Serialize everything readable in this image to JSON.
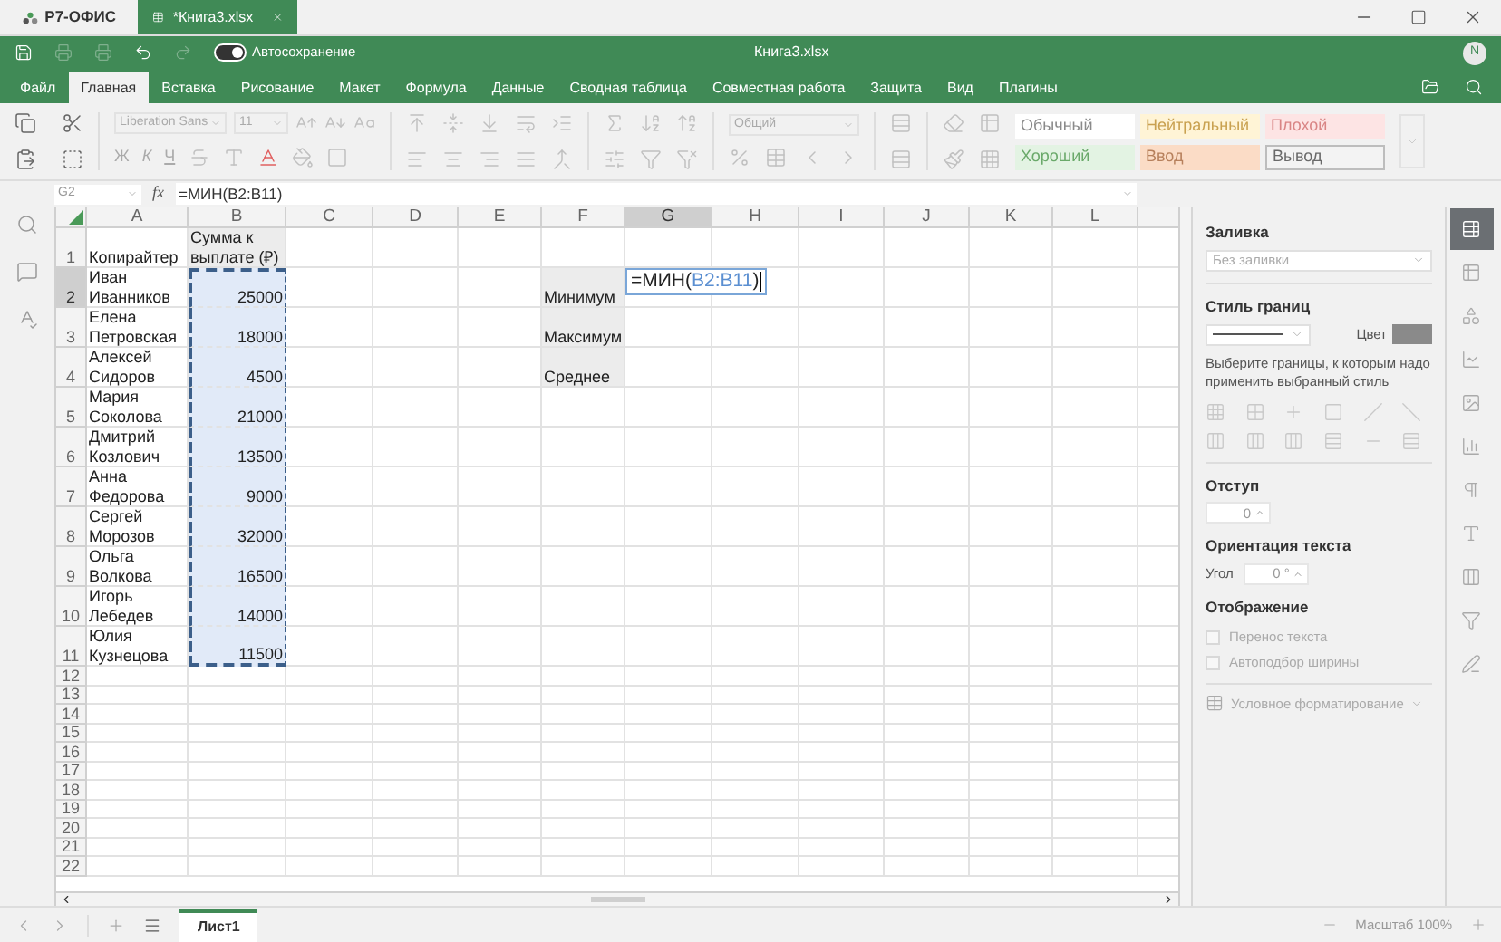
{
  "title_bar": {
    "app_name": "Р7-ОФИС",
    "document_tab": "*Книга3.xlsx"
  },
  "quick_bar": {
    "autosave": {
      "label": "Автосохранение",
      "on": true
    },
    "document_title": "Книга3.xlsx",
    "user_initial": "N"
  },
  "menu_tabs": [
    {
      "label": "Файл",
      "selected": false
    },
    {
      "label": "Главная",
      "selected": true
    },
    {
      "label": "Вставка",
      "selected": false
    },
    {
      "label": "Рисование",
      "selected": false
    },
    {
      "label": "Макет",
      "selected": false
    },
    {
      "label": "Формула",
      "selected": false
    },
    {
      "label": "Данные",
      "selected": false
    },
    {
      "label": "Сводная таблица",
      "selected": false
    },
    {
      "label": "Совместная работа",
      "selected": false
    },
    {
      "label": "Защита",
      "selected": false
    },
    {
      "label": "Вид",
      "selected": false
    },
    {
      "label": "Плагины",
      "selected": false
    }
  ],
  "ribbon": {
    "font_name": "Liberation Sans",
    "font_size": "11",
    "format_letters": [
      "Ж",
      "К",
      "Ч"
    ],
    "number_format": "Общий",
    "cell_styles": [
      {
        "label": "Обычный",
        "kind": "normal"
      },
      {
        "label": "Нейтральный",
        "kind": "neutral"
      },
      {
        "label": "Плохой",
        "kind": "bad"
      },
      {
        "label": "Хороший",
        "kind": "good"
      },
      {
        "label": "Ввод",
        "kind": "input"
      },
      {
        "label": "Вывод",
        "kind": "output"
      }
    ]
  },
  "formula_bar": {
    "cell_ref": "G2",
    "fx_label": "fx",
    "formula": "=МИН(B2:B11)"
  },
  "sheet": {
    "columns": [
      {
        "label": "A",
        "selected": false
      },
      {
        "label": "B",
        "selected": false
      },
      {
        "label": "C",
        "selected": false
      },
      {
        "label": "D",
        "selected": false
      },
      {
        "label": "E",
        "selected": false
      },
      {
        "label": "F",
        "selected": false
      },
      {
        "label": "G",
        "selected": true
      },
      {
        "label": "H",
        "selected": false
      },
      {
        "label": "I",
        "selected": false
      },
      {
        "label": "J",
        "selected": false
      },
      {
        "label": "K",
        "selected": false
      },
      {
        "label": "L",
        "selected": false
      }
    ],
    "rows": [
      {
        "header": "1",
        "selected": false,
        "cells": [
          {
            "text": "Копирайтер"
          },
          {
            "text": "Сумма к выплате (₽)",
            "shaded": true
          }
        ]
      },
      {
        "header": "2",
        "selected": true,
        "cells": [
          {
            "text": "Иван Иванников"
          },
          {
            "text": "25000",
            "highlighted": true
          },
          {
            "text": ""
          },
          {
            "text": ""
          },
          {
            "text": ""
          },
          {
            "text": "Минимум",
            "shaded": true
          },
          {
            "kind": "editing",
            "parts": [
              {
                "text": "=МИН(",
                "kind": "plain"
              },
              {
                "text": "B2:B11",
                "kind": "ref"
              },
              {
                "text": ")",
                "kind": "plain"
              }
            ]
          }
        ]
      },
      {
        "header": "3",
        "selected": false,
        "cells": [
          {
            "text": "Елена Петровская"
          },
          {
            "text": "18000",
            "highlighted": true
          },
          {
            "text": ""
          },
          {
            "text": ""
          },
          {
            "text": ""
          },
          {
            "text": "Максимум",
            "shaded": true
          }
        ]
      },
      {
        "header": "4",
        "selected": false,
        "cells": [
          {
            "text": "Алексей Сидоров"
          },
          {
            "text": "4500",
            "highlighted": true
          },
          {
            "text": ""
          },
          {
            "text": ""
          },
          {
            "text": ""
          },
          {
            "text": "Среднее",
            "shaded": true
          }
        ]
      },
      {
        "header": "5",
        "selected": false,
        "cells": [
          {
            "text": "Мария Соколова"
          },
          {
            "text": "21000",
            "highlighted": true
          }
        ]
      },
      {
        "header": "6",
        "selected": false,
        "cells": [
          {
            "text": "Дмитрий Козлович"
          },
          {
            "text": "13500",
            "highlighted": true
          }
        ]
      },
      {
        "header": "7",
        "selected": false,
        "cells": [
          {
            "text": "Анна Федорова"
          },
          {
            "text": "9000",
            "highlighted": true
          }
        ]
      },
      {
        "header": "8",
        "selected": false,
        "cells": [
          {
            "text": "Сергей Морозов"
          },
          {
            "text": "32000",
            "highlighted": true
          }
        ]
      },
      {
        "header": "9",
        "selected": false,
        "cells": [
          {
            "text": "Ольга Волкова"
          },
          {
            "text": "16500",
            "highlighted": true
          }
        ]
      },
      {
        "header": "10",
        "selected": false,
        "cells": [
          {
            "text": "Игорь Лебедев"
          },
          {
            "text": "14000",
            "highlighted": true
          }
        ]
      },
      {
        "header": "11",
        "selected": false,
        "cells": [
          {
            "text": "Юлия Кузнецова"
          },
          {
            "text": "11500",
            "highlighted": true
          }
        ]
      },
      {
        "header": "12",
        "selected": false,
        "cells": []
      },
      {
        "header": "13",
        "selected": false,
        "cells": []
      },
      {
        "header": "14",
        "selected": false,
        "cells": []
      },
      {
        "header": "15",
        "selected": false,
        "cells": []
      },
      {
        "header": "16",
        "selected": false,
        "cells": []
      },
      {
        "header": "17",
        "selected": false,
        "cells": []
      },
      {
        "header": "18",
        "selected": false,
        "cells": []
      },
      {
        "header": "19",
        "selected": false,
        "cells": []
      },
      {
        "header": "20",
        "selected": false,
        "cells": []
      },
      {
        "header": "21",
        "selected": false,
        "cells": []
      },
      {
        "header": "22",
        "selected": false,
        "cells": []
      }
    ]
  },
  "settings_panel": {
    "fill": {
      "title": "Заливка",
      "value": "Без заливки"
    },
    "borders": {
      "title": "Стиль границ",
      "color_label": "Цвет",
      "hint": "Выберите границы, к которым надо применить выбранный стиль"
    },
    "indent": {
      "title": "Отступ",
      "value": "0"
    },
    "orientation": {
      "title": "Ориентация текста",
      "angle_label": "Угол",
      "value": "0 °"
    },
    "display": {
      "title": "Отображение",
      "options": [
        {
          "label": "Перенос текста",
          "checked": false
        },
        {
          "label": "Автоподбор ширины",
          "checked": false
        }
      ]
    },
    "conditional_formatting": "Условное форматирование"
  },
  "right_toolbar": [
    {
      "kind": "cell",
      "selected": true
    },
    {
      "kind": "table",
      "selected": false
    },
    {
      "kind": "shape",
      "selected": false
    },
    {
      "kind": "chart",
      "selected": false
    },
    {
      "kind": "image",
      "selected": false
    },
    {
      "kind": "sparkline",
      "selected": false
    },
    {
      "kind": "paragraph",
      "selected": false
    },
    {
      "kind": "textart",
      "selected": false
    },
    {
      "kind": "pivot",
      "selected": false
    },
    {
      "kind": "slicer",
      "selected": false
    },
    {
      "kind": "signature",
      "selected": false
    }
  ],
  "status_bar": {
    "sheet_tabs": [
      {
        "label": "Лист1",
        "selected": true
      }
    ],
    "zoom_label": "Масштаб 100%"
  }
}
